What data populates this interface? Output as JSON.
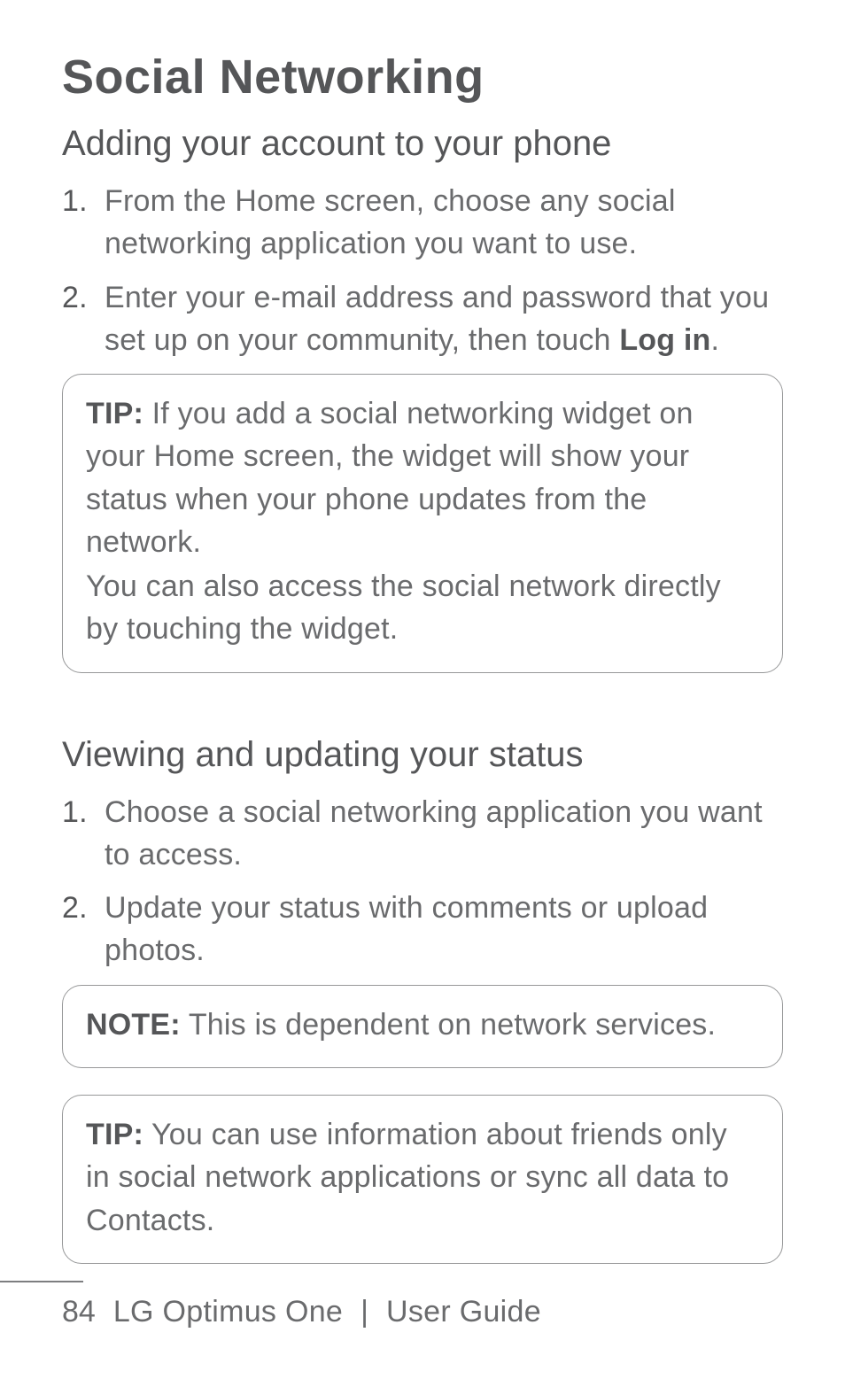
{
  "heading": "Social Networking",
  "section1": {
    "title": "Adding your account to your phone",
    "steps": [
      {
        "num": "1.",
        "text": "From the Home screen, choose any social networking application you want to use."
      },
      {
        "num": "2.",
        "prefix": "Enter your e-mail address and password that you set up on your community, then touch ",
        "bold": "Log in",
        "suffix": "."
      }
    ],
    "tip": {
      "lead": "TIP:",
      "para1": " If you add a social networking widget on your Home screen, the widget will show your status when your phone updates from the network.",
      "para2": "You can also access the social network directly by touching the widget."
    }
  },
  "section2": {
    "title": "Viewing and updating your status",
    "steps": [
      {
        "num": "1.",
        "text": "Choose a social networking application you want to access."
      },
      {
        "num": "2.",
        "text": "Update your status with comments or upload photos."
      }
    ],
    "note": {
      "lead": "NOTE:",
      "text": " This is dependent on network services."
    },
    "tip": {
      "lead": "TIP:",
      "text": " You can use information about friends only in social network applications or sync all data to Contacts."
    }
  },
  "footer": {
    "page_number": "84",
    "doc_title": "LG Optimus One",
    "separator": "|",
    "doc_sub": "User Guide"
  }
}
